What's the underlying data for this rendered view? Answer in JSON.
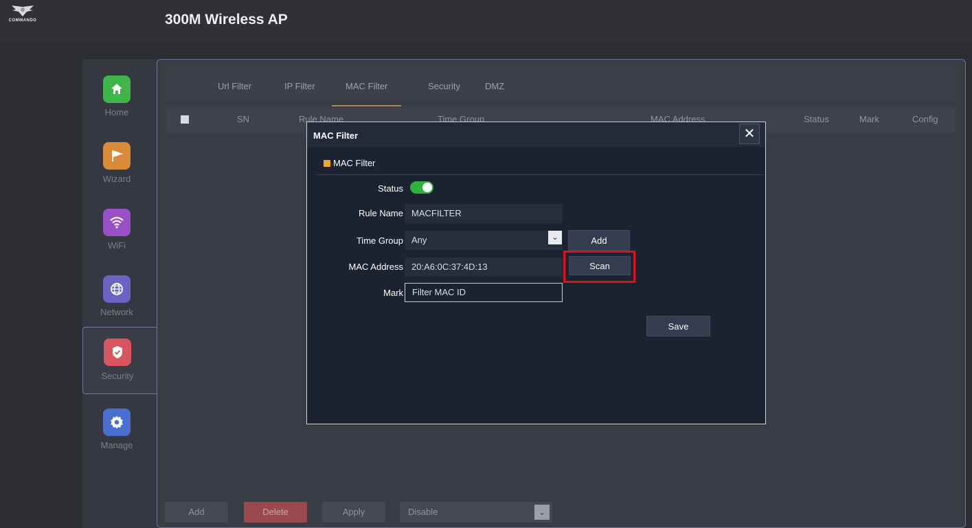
{
  "header": {
    "title": "300M Wireless AP",
    "logo_text": "COMMANDO"
  },
  "sidebar": {
    "items": [
      {
        "label": "Home",
        "icon": "home-icon",
        "color": "#3fb54a"
      },
      {
        "label": "Wizard",
        "icon": "flag-icon",
        "color": "#d98b3a"
      },
      {
        "label": "WiFi",
        "icon": "wifi-icon",
        "color": "#9b4fc7"
      },
      {
        "label": "Network",
        "icon": "globe-icon",
        "color": "#6b63c4"
      },
      {
        "label": "Security",
        "icon": "shield-icon",
        "color": "#d7565e",
        "active": true
      },
      {
        "label": "Manage",
        "icon": "gear-icon",
        "color": "#4a6fd1"
      }
    ]
  },
  "tabs": [
    "Url Filter",
    "IP Filter",
    "MAC Filter",
    "Security",
    "DMZ"
  ],
  "active_tab": "MAC Filter",
  "table": {
    "columns": [
      "SN",
      "Rule Name",
      "Time Group",
      "MAC Address",
      "Status",
      "Mark",
      "Config"
    ]
  },
  "bottom_bar": {
    "add": "Add",
    "delete": "Delete",
    "apply": "Apply",
    "select_value": "Disable"
  },
  "modal": {
    "title": "MAC Filter",
    "section": "MAC Filter",
    "status_label": "Status",
    "status_on": true,
    "rule_name_label": "Rule Name",
    "rule_name_value": "MACFILTER",
    "time_group_label": "Time Group",
    "time_group_value": "Any",
    "add_button": "Add",
    "mac_label": "MAC Address",
    "mac_value": "20:A6:0C:37:4D:13",
    "scan_button": "Scan",
    "mark_label": "Mark",
    "mark_placeholder": "Filter MAC ID",
    "save_button": "Save"
  },
  "colors": {
    "highlight": "#e0101a",
    "toggle_on": "#2fb13b",
    "section_marker": "#f5a623"
  }
}
